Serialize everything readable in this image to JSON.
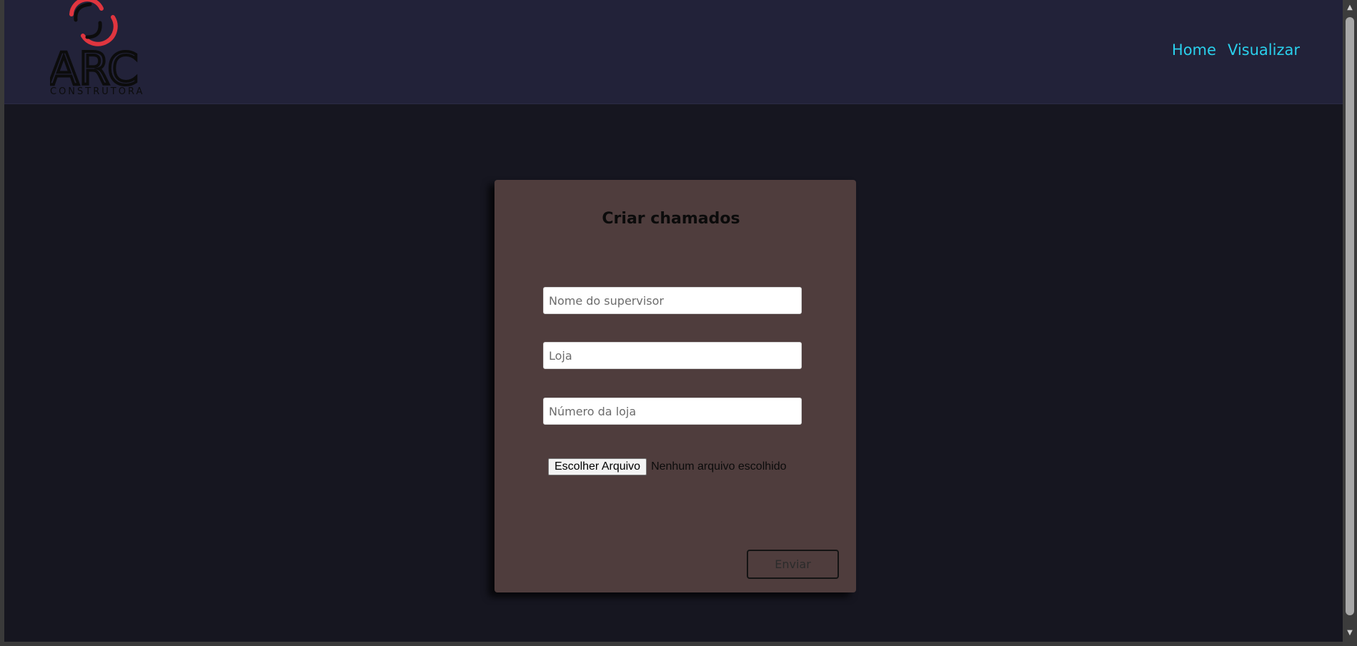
{
  "header": {
    "logo": {
      "text": "ARC",
      "subtitle": "CONSTRUTORA",
      "accent_color": "#e0353f",
      "icon": "arc-logo-icon"
    },
    "nav": [
      {
        "label": "Home"
      },
      {
        "label": "Visualizar"
      }
    ]
  },
  "form": {
    "title": "Criar chamados",
    "fields": [
      {
        "placeholder": "Nome do supervisor",
        "value": ""
      },
      {
        "placeholder": "Loja",
        "value": ""
      },
      {
        "placeholder": "Número da loja",
        "value": ""
      }
    ],
    "file": {
      "button_label": "Escolher Arquivo",
      "status": "Nenhum arquivo escolhido"
    },
    "submit_label": "Enviar"
  },
  "colors": {
    "header_bg": "#222239",
    "page_bg": "#161620",
    "card_bg": "#4f3d3d",
    "nav_link": "#2ad0ec"
  }
}
